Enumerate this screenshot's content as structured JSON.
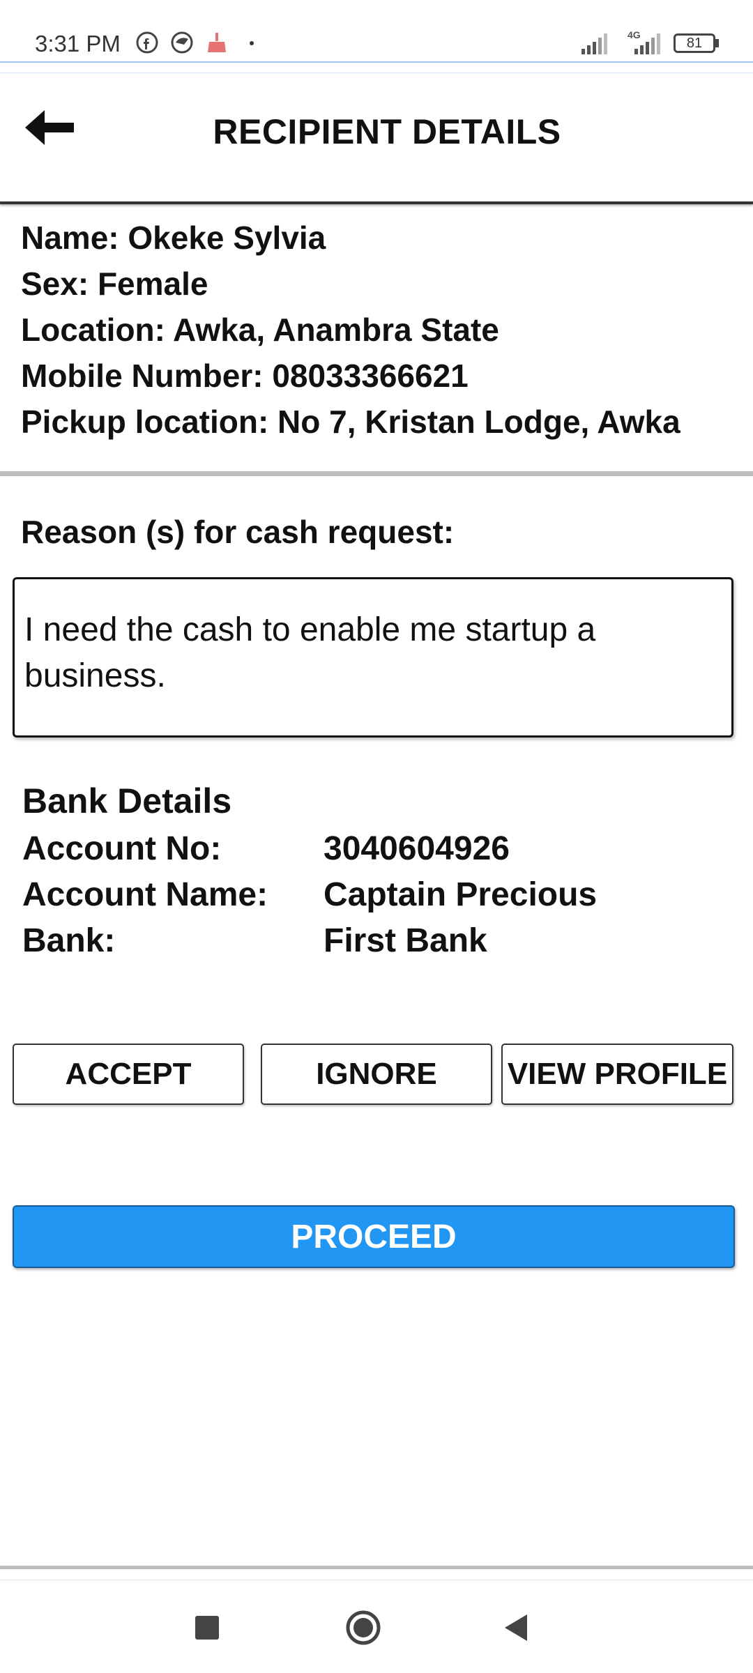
{
  "status_bar": {
    "time": "3:31 PM",
    "battery": "81",
    "network": "4G",
    "icons": [
      "facebook-icon",
      "browser-icon",
      "cleaner-icon",
      "dot-icon",
      "signal-icon",
      "signal-4g-icon",
      "battery-icon"
    ]
  },
  "header": {
    "title": "RECIPIENT DETAILS",
    "back_icon": "arrow-left-icon"
  },
  "recipient": {
    "name": "Name: Okeke Sylvia",
    "sex": "Sex: Female",
    "location": "Location: Awka, Anambra State",
    "mobile": "Mobile Number: 08033366621",
    "pickup": "Pickup location: No 7, Kristan Lodge, Awka"
  },
  "reason": {
    "label": "Reason (s) for cash request:",
    "text": "I need the cash to enable me startup a business."
  },
  "bank": {
    "title": "Bank Details",
    "rows": [
      {
        "label": "Account No:",
        "value": "3040604926"
      },
      {
        "label": "Account Name:",
        "value": "Captain Precious"
      },
      {
        "label": "Bank:",
        "value": "First Bank"
      }
    ]
  },
  "actions": {
    "accept": "ACCEPT",
    "ignore": "IGNORE",
    "view_profile": "VIEW PROFILE",
    "proceed": "PROCEED"
  },
  "colors": {
    "primary": "#2196f3",
    "text": "#111111",
    "divider": "#bdbdbd"
  },
  "nav_bar": {
    "icons": [
      "recents-square-icon",
      "home-circle-icon",
      "back-triangle-icon"
    ]
  }
}
